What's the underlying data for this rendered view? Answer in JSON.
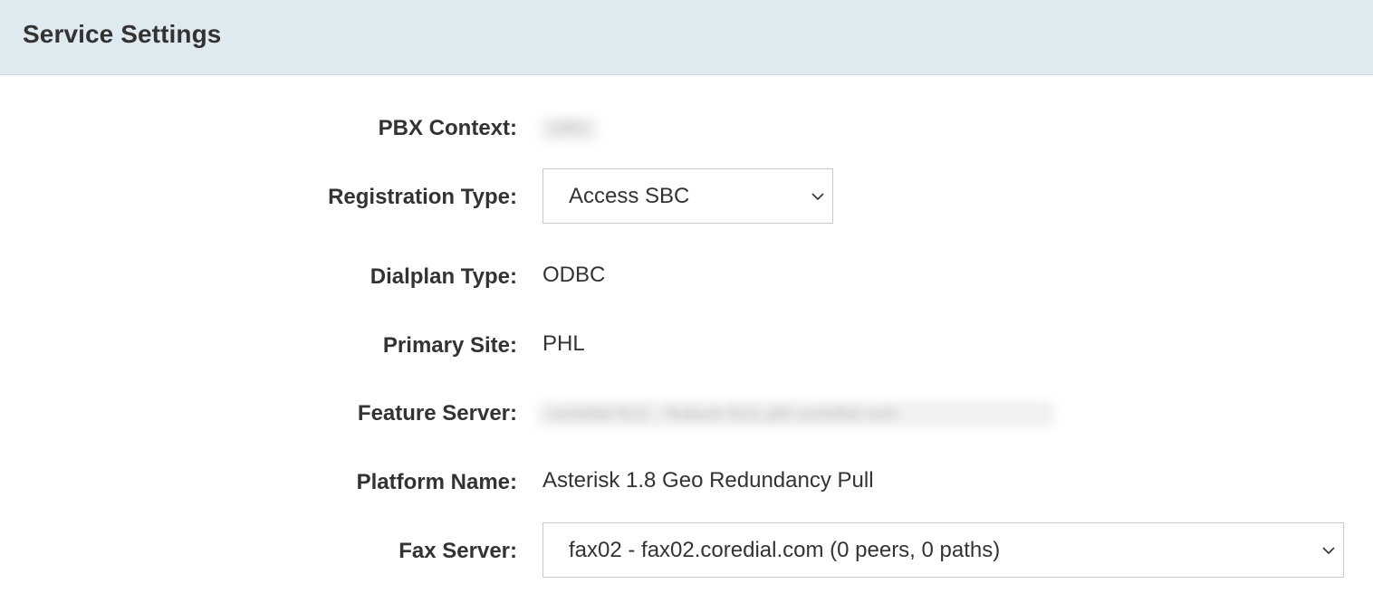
{
  "panel": {
    "title": "Service Settings"
  },
  "fields": {
    "pbx_context": {
      "label": "PBX Context:",
      "value": "1001"
    },
    "registration_type": {
      "label": "Registration Type:",
      "selected": "Access SBC",
      "icon": "chevron-down-icon"
    },
    "dialplan_type": {
      "label": "Dialplan Type:",
      "value": "ODBC"
    },
    "primary_site": {
      "label": "Primary Site:",
      "value": "PHL"
    },
    "feature_server": {
      "label": "Feature Server:",
      "value": "coredial-fs11 - feature-fs11.phl.coredial.com"
    },
    "platform_name": {
      "label": "Platform Name:",
      "value": "Asterisk 1.8 Geo Redundancy Pull"
    },
    "fax_server": {
      "label": "Fax Server:",
      "selected": "fax02 - fax02.coredial.com (0 peers, 0 paths)",
      "icon": "chevron-down-icon"
    }
  },
  "colors": {
    "header_bg": "#dfe9f0",
    "text": "#333333",
    "border": "#c8c8c8"
  }
}
